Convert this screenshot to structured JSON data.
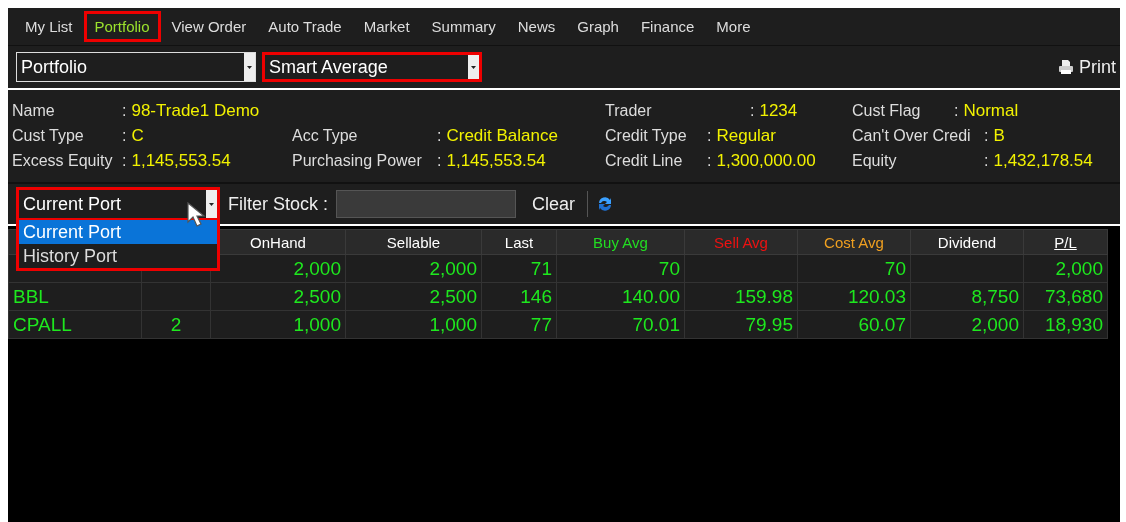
{
  "tabs": [
    {
      "label": "My List",
      "selected": false,
      "highlighted": false
    },
    {
      "label": "Portfolio",
      "selected": true,
      "highlighted": true
    },
    {
      "label": "View Order",
      "selected": false,
      "highlighted": false
    },
    {
      "label": "Auto Trade",
      "selected": false,
      "highlighted": false
    },
    {
      "label": "Market",
      "selected": false,
      "highlighted": false
    },
    {
      "label": "Summary",
      "selected": false,
      "highlighted": false
    },
    {
      "label": "News",
      "selected": false,
      "highlighted": false
    },
    {
      "label": "Graph",
      "selected": false,
      "highlighted": false
    },
    {
      "label": "Finance",
      "selected": false,
      "highlighted": false
    },
    {
      "label": "More",
      "selected": false,
      "highlighted": false
    }
  ],
  "selectors": [
    {
      "value": "Portfolio",
      "highlighted": false
    },
    {
      "value": "Smart Average",
      "highlighted": true
    }
  ],
  "print_button": {
    "label": "Print"
  },
  "account_info": [
    [
      {
        "label": "Name",
        "sep": ":",
        "value": "98-Trade1 Demo"
      },
      {
        "label": "Trader",
        "sep": ":",
        "value": "1234"
      },
      {
        "label": "Cust Flag",
        "sep": ":",
        "value": "Normal"
      }
    ],
    [
      {
        "label": "Cust Type",
        "sep": ":",
        "value": "C"
      },
      {
        "label": "Acc Type",
        "sep": ":",
        "value": "Credit Balance"
      },
      {
        "label": "Credit Type",
        "sep": ":",
        "value": "Regular"
      },
      {
        "label": "Can't Over Credi",
        "sep": ":",
        "value": "B"
      }
    ],
    [
      {
        "label": "Excess Equity",
        "sep": ":",
        "value": "1,145,553.54"
      },
      {
        "label": "Purchasing Power",
        "sep": ":",
        "value": "1,145,553.54"
      },
      {
        "label": "Credit Line",
        "sep": ":",
        "value": "1,300,000.00"
      },
      {
        "label": "Equity",
        "sep": ":",
        "value": "1,432,178.54"
      }
    ]
  ],
  "port_dropdown": {
    "value": "Current Port",
    "highlighted": true,
    "expanded": true,
    "options": [
      {
        "label": "Current Port",
        "selected": true
      },
      {
        "label": "History Port",
        "selected": false
      }
    ]
  },
  "filter": {
    "label": "Filter Stock :",
    "clear_label": "Clear"
  },
  "table": {
    "columns": [
      {},
      {},
      {
        "label": "OnHand"
      },
      {
        "label": "Sellable"
      },
      {
        "label": "Last"
      },
      {
        "label": "Buy Avg",
        "color": "#22dd22"
      },
      {
        "label": "Sell Avg",
        "color": "#ee1111"
      },
      {
        "label": "Cost Avg",
        "color": "#f0a020"
      },
      {
        "label": "Dividend"
      },
      {
        "label": "P/L"
      }
    ],
    "rows": [
      [
        "",
        "",
        "2,000",
        "2,000",
        "71",
        "70",
        "",
        "70",
        "",
        "2,000"
      ],
      [
        "BBL",
        "",
        "2,500",
        "2,500",
        "146",
        "140.00",
        "159.98",
        "120.03",
        "8,750",
        "73,680"
      ],
      [
        "CPALL",
        "2",
        "1,000",
        "1,000",
        "77",
        "70.01",
        "79.95",
        "60.07",
        "2,000",
        "18,930"
      ]
    ]
  }
}
